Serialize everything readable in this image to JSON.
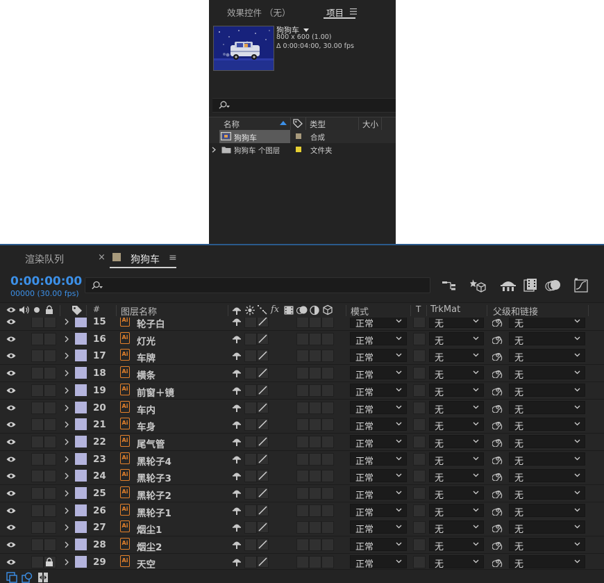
{
  "project_panel": {
    "tabs": [
      {
        "label": "效果控件 （无）"
      },
      {
        "label": "项目"
      }
    ],
    "menu_icon": "hamburger-icon",
    "comp": {
      "name": "狗狗车",
      "size": "800 x 600 (1.00)",
      "duration": "Δ 0:00:04:00, 30.00 fps"
    },
    "columns": [
      "名称",
      "类型",
      "大小"
    ],
    "items": [
      {
        "name": "狗狗车",
        "type": "合成",
        "label_color": "#a89a7c",
        "icon": "composition-icon"
      },
      {
        "name": "狗狗车 个图层",
        "type": "文件夹",
        "label_color": "#e6cf32",
        "icon": "folder-icon"
      }
    ]
  },
  "timeline": {
    "tabs": [
      {
        "label": "渲染队列"
      },
      {
        "label": "狗狗车"
      }
    ],
    "close_glyph": "×",
    "menu_glyph": "≡",
    "current_time": "0:00:00:00",
    "frame_info": "00000 (30.00 fps)",
    "columns": {
      "hash": "#",
      "layer_name": "图层名称",
      "fx": "fx",
      "mode": "模式",
      "t": "T",
      "trkmat": "TrkMat",
      "parent": "父级和链接"
    },
    "layers": [
      {
        "num": "15",
        "name": "轮子白",
        "mode": "正常",
        "trkmat": "无",
        "parent": "无",
        "locked": false
      },
      {
        "num": "16",
        "name": "灯光",
        "mode": "正常",
        "trkmat": "无",
        "parent": "无",
        "locked": false
      },
      {
        "num": "17",
        "name": "车牌",
        "mode": "正常",
        "trkmat": "无",
        "parent": "无",
        "locked": false
      },
      {
        "num": "18",
        "name": "横条",
        "mode": "正常",
        "trkmat": "无",
        "parent": "无",
        "locked": false
      },
      {
        "num": "19",
        "name": "前窗＋镜",
        "mode": "正常",
        "trkmat": "无",
        "parent": "无",
        "locked": false
      },
      {
        "num": "20",
        "name": "车内",
        "mode": "正常",
        "trkmat": "无",
        "parent": "无",
        "locked": false
      },
      {
        "num": "21",
        "name": "车身",
        "mode": "正常",
        "trkmat": "无",
        "parent": "无",
        "locked": false
      },
      {
        "num": "22",
        "name": "尾气管",
        "mode": "正常",
        "trkmat": "无",
        "parent": "无",
        "locked": false
      },
      {
        "num": "23",
        "name": "黑轮子4",
        "mode": "正常",
        "trkmat": "无",
        "parent": "无",
        "locked": false
      },
      {
        "num": "24",
        "name": "黑轮子3",
        "mode": "正常",
        "trkmat": "无",
        "parent": "无",
        "locked": false
      },
      {
        "num": "25",
        "name": "黑轮子2",
        "mode": "正常",
        "trkmat": "无",
        "parent": "无",
        "locked": false
      },
      {
        "num": "26",
        "name": "黑轮子1",
        "mode": "正常",
        "trkmat": "无",
        "parent": "无",
        "locked": false
      },
      {
        "num": "27",
        "name": "烟尘1",
        "mode": "正常",
        "trkmat": "无",
        "parent": "无",
        "locked": false
      },
      {
        "num": "28",
        "name": "烟尘2",
        "mode": "正常",
        "trkmat": "无",
        "parent": "无",
        "locked": false
      },
      {
        "num": "29",
        "name": "天空",
        "mode": "正常",
        "trkmat": "无",
        "parent": "无",
        "locked": true
      }
    ],
    "layer_label_color": "#b4b4dd",
    "layer_icon": "ai-file-icon",
    "accent_color": "#3c90e8"
  }
}
